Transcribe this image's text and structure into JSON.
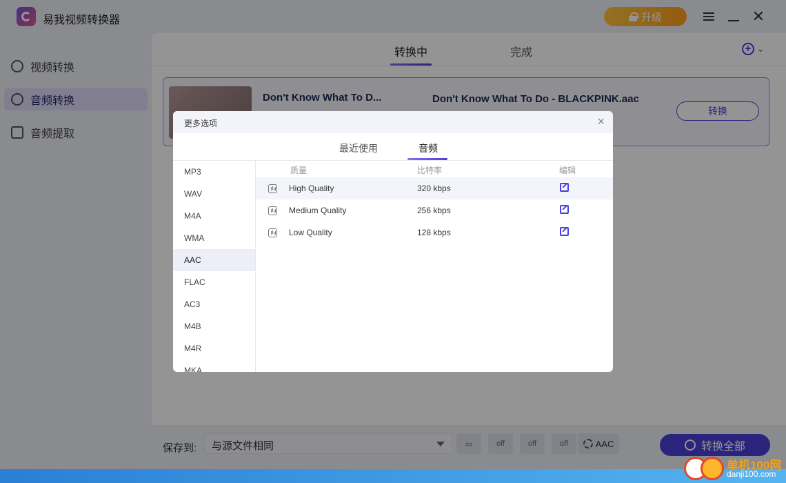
{
  "app": {
    "title": "易我视频转换器",
    "upgrade_label": "升级"
  },
  "sidebar": {
    "items": [
      {
        "label": "视频转换"
      },
      {
        "label": "音频转换"
      },
      {
        "label": "音频提取"
      }
    ]
  },
  "main": {
    "tabs": [
      {
        "label": "转换中"
      },
      {
        "label": "完成"
      }
    ],
    "file": {
      "name": "Don't Know What To D...",
      "output_name": "Don't Know What To Do - BLACKPINK.aac",
      "convert_label": "转换"
    }
  },
  "bottom": {
    "save_label": "保存到:",
    "save_value": "与源文件相同",
    "format_label": "AAC",
    "convert_all_label": "转换全部",
    "tool_off": "off"
  },
  "dialog": {
    "title": "更多选项",
    "tabs": [
      {
        "label": "最近使用"
      },
      {
        "label": "音频"
      }
    ],
    "formats": [
      "MP3",
      "WAV",
      "M4A",
      "WMA",
      "AAC",
      "FLAC",
      "AC3",
      "M4B",
      "M4R",
      "MKA"
    ],
    "columns": {
      "quality": "质量",
      "bitrate": "比特率",
      "edit": "编辑"
    },
    "rows": [
      {
        "name": "High Quality",
        "bitrate": "320 kbps"
      },
      {
        "name": "Medium Quality",
        "bitrate": "256 kbps"
      },
      {
        "name": "Low Quality",
        "bitrate": "128 kbps"
      }
    ]
  },
  "watermark": {
    "text": "单机100网",
    "url": "danji100.com"
  }
}
